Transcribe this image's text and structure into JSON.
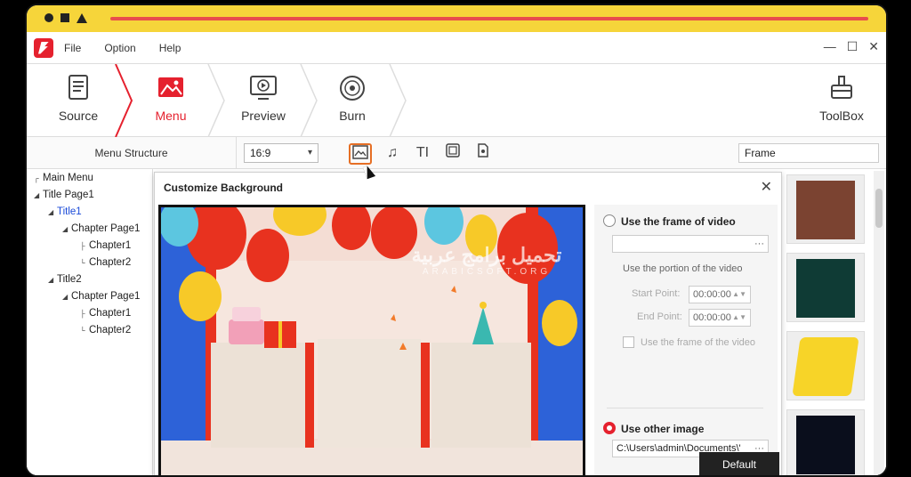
{
  "menubar": {
    "items": [
      "File",
      "Option",
      "Help"
    ],
    "controls": [
      "—",
      "☐",
      "✕"
    ]
  },
  "steps": [
    {
      "label": "Source",
      "icon": "document-icon"
    },
    {
      "label": "Menu",
      "icon": "picture-icon",
      "active": true
    },
    {
      "label": "Preview",
      "icon": "monitor-play-icon"
    },
    {
      "label": "Burn",
      "icon": "disc-icon"
    }
  ],
  "toolbox": {
    "label": "ToolBox",
    "icon": "toolbox-icon"
  },
  "toolbar": {
    "menu_structure": "Menu Structure",
    "aspect_ratio": "16:9",
    "tools": [
      "background-image-icon",
      "music-icon",
      "text-icon",
      "frame-icon",
      "file-icon"
    ],
    "frame_field": "Frame"
  },
  "tree": [
    {
      "label": "Main Menu"
    },
    {
      "label": "Title Page1"
    },
    {
      "label": "Title1"
    },
    {
      "label": "Chapter Page1"
    },
    {
      "label": "Chapter1"
    },
    {
      "label": "Chapter2"
    },
    {
      "label": "Title2"
    },
    {
      "label": "Chapter Page1"
    },
    {
      "label": "Chapter1"
    },
    {
      "label": "Chapter2"
    }
  ],
  "dialog": {
    "title": "Customize Background",
    "close": "✕",
    "use_frame_label": "Use the frame of video",
    "use_portion_label": "Use the portion of the video",
    "start_point_label": "Start Point:",
    "start_point_value": "00:00:00",
    "end_point_label": "End Point:",
    "end_point_value": "00:00:00",
    "use_frame_checkbox_label": "Use the frame of the video",
    "use_other_label": "Use other image",
    "image_path": "C:\\Users\\admin\\Documents\\'",
    "default_button": "Default"
  },
  "watermark": {
    "title": "تحميل برامج عربية",
    "subtitle": "ARABICSOFT.ORG"
  },
  "frame_colors": [
    "#7b4331",
    "#0f3b35",
    "#f7d428",
    "#0a0e1c"
  ],
  "colors": {
    "accent": "#e5212e",
    "highlight": "#e66f25",
    "browser_bar": "#f6d53a"
  }
}
